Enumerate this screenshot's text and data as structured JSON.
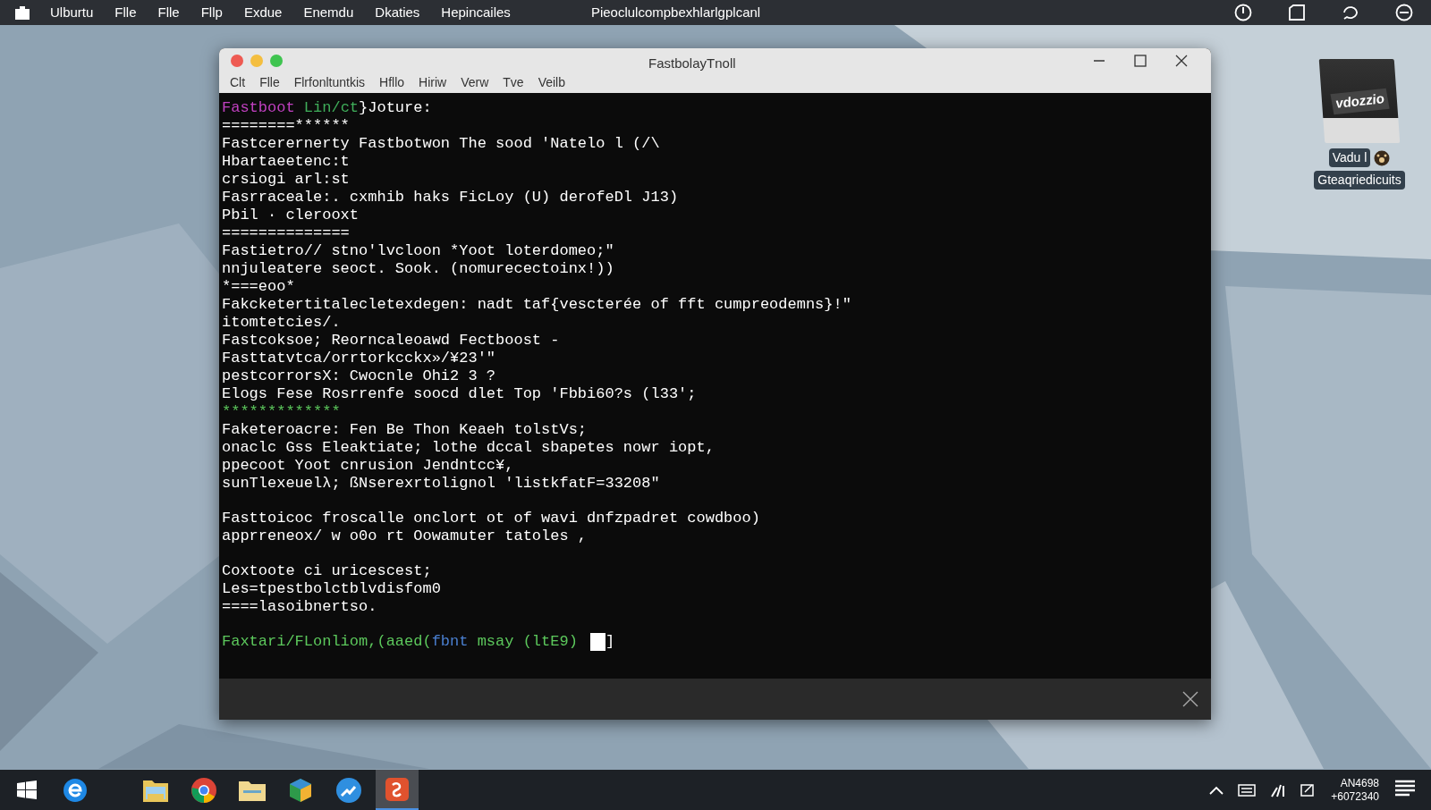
{
  "top_bar": {
    "menu": [
      "Ulburtu",
      "Flle",
      "Flle",
      "Fllp",
      "Exdue",
      "Enemdu",
      "Dkaties",
      "Hepincailes"
    ],
    "title": "Pieoclulcompbexhlarlgplcanl"
  },
  "window": {
    "title": "FastbolayTnoll",
    "menu": [
      "Clt",
      "Flle",
      "Flrfonltuntkis",
      "Hfllo",
      "Hiriw",
      "Verw",
      "Tve",
      "Veilb"
    ]
  },
  "terminal": {
    "blocks": [
      {
        "lines": [
          {
            "segments": [
              {
                "text": "Fastboot ",
                "color": "#c040c0"
              },
              {
                "text": "Lin/ct",
                "color": "#3fae5a"
              },
              {
                "text": "}Joture:",
                "color": "#ffffff"
              }
            ]
          },
          {
            "segments": [
              {
                "text": "========******",
                "color": "#ffffff"
              }
            ]
          },
          {
            "segments": [
              {
                "text": "Fastcerernerty Fastbotwon The sood 'Natelo l (/\\",
                "color": "#ffffff"
              }
            ]
          },
          {
            "segments": [
              {
                "text": "Hbartaeetenc:t",
                "color": "#ffffff"
              }
            ]
          },
          {
            "segments": [
              {
                "text": "crsiogi arl:st",
                "color": "#ffffff"
              }
            ]
          },
          {
            "segments": [
              {
                "text": "Fasrraceale:. cxmhib haks FicLoy (U) derofeDl J13)",
                "color": "#ffffff"
              }
            ]
          },
          {
            "segments": [
              {
                "text": "Pbil · clerooxt",
                "color": "#ffffff"
              }
            ]
          },
          {
            "segments": [
              {
                "text": "==============",
                "color": "#ffffff"
              }
            ]
          },
          {
            "segments": [
              {
                "text": "Fastietro// stno'lvcloon *Yoot loterdomeo;\"",
                "color": "#ffffff"
              }
            ]
          },
          {
            "segments": [
              {
                "text": "nnjuleatere seoct. Sook. (nomurecectoinx!))",
                "color": "#ffffff"
              }
            ]
          },
          {
            "segments": [
              {
                "text": "*===eoo*",
                "color": "#ffffff"
              }
            ]
          },
          {
            "segments": [
              {
                "text": "Fakcketertitalecletexdegen: nadt taf{vescterée of fft cumpreodemns}!\"",
                "color": "#ffffff"
              }
            ]
          },
          {
            "segments": [
              {
                "text": "itomtetcies/.",
                "color": "#ffffff"
              }
            ]
          },
          {
            "segments": [
              {
                "text": "Fastcoksoe; Reorncaleoawd Fectboost -",
                "color": "#ffffff"
              }
            ]
          },
          {
            "segments": [
              {
                "text": "Fasttatvtca/orrtorkcckx»/¥23'\"",
                "color": "#ffffff"
              }
            ]
          },
          {
            "segments": [
              {
                "text": "pestcorrorsX: Cwocnle Ohi2 3 ?",
                "color": "#ffffff"
              }
            ]
          },
          {
            "segments": [
              {
                "text": "Elogs Fese Rosrrenfe soocd dlet Top 'Fbbi60?s (l33';",
                "color": "#ffffff"
              }
            ]
          },
          {
            "segments": [
              {
                "text": "*************",
                "color": "#5cc85c"
              }
            ]
          },
          {
            "segments": [
              {
                "text": "Faketeroacre: Fen Be Thon Keaeh tolstVs;",
                "color": "#ffffff"
              }
            ]
          },
          {
            "segments": [
              {
                "text": "onaclc Gss Eleaktiate; lothe dccal sbapetes nowr iopt,",
                "color": "#ffffff"
              }
            ]
          },
          {
            "segments": [
              {
                "text": "ppecoot Yoot cnrusion Jendntcc¥,",
                "color": "#ffffff"
              }
            ]
          },
          {
            "segments": [
              {
                "text": "sunTlexeuelλ; ßNserexrtolignol 'listkfatF=33208\"",
                "color": "#ffffff"
              }
            ]
          }
        ]
      },
      {
        "lines": [
          {
            "segments": [
              {
                "text": "Fasttoicoc froscalle onclort ot of wavi dnfzpadret cowdboo)",
                "color": "#ffffff"
              }
            ]
          },
          {
            "segments": [
              {
                "text": "apprreneox/ w o0o rt Oowamuter tatoles ,",
                "color": "#ffffff"
              }
            ]
          }
        ]
      },
      {
        "lines": [
          {
            "segments": [
              {
                "text": "Coxtoote ci uricescest;",
                "color": "#ffffff"
              }
            ]
          },
          {
            "segments": [
              {
                "text": "Les=tpestbolctblvdisfom0",
                "color": "#ffffff"
              }
            ]
          },
          {
            "segments": [
              {
                "text": "====lasoibnertso.",
                "color": "#ffffff"
              }
            ]
          }
        ]
      },
      {
        "lines": [
          {
            "segments": [
              {
                "text": "Faxtari/FLonliom,(aaed(",
                "color": "#5cc85c"
              },
              {
                "text": "fbnt",
                "color": "#4a7fd0"
              },
              {
                "text": " msay (ltE9) ",
                "color": "#5cc85c"
              }
            ]
          }
        ]
      }
    ],
    "prompt_end": "]"
  },
  "desktop_icon": {
    "logo_text": "vdozzio",
    "label_1": "Vadu l",
    "label_2": "Gteaqriedicuits"
  },
  "taskbar": {
    "apps": [
      {
        "kind": "start",
        "selected": false
      },
      {
        "kind": "browser-e",
        "selected": false
      },
      {
        "kind": "folder",
        "selected": false
      },
      {
        "kind": "chrome",
        "selected": false
      },
      {
        "kind": "folder-flat",
        "selected": false
      },
      {
        "kind": "box",
        "selected": false
      },
      {
        "kind": "bubble",
        "selected": false
      },
      {
        "kind": "red-app",
        "selected": true
      }
    ],
    "clock_line_1": "AN4698",
    "clock_line_2": "+6072340"
  }
}
